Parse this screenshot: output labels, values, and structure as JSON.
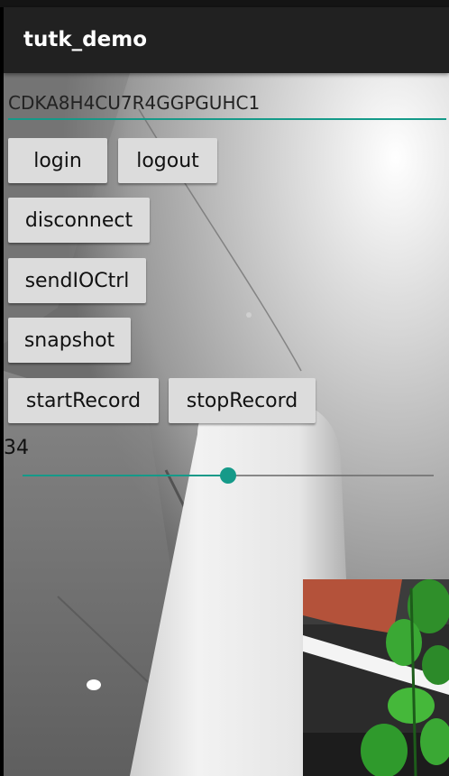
{
  "app_bar": {
    "title": "tutk_demo"
  },
  "uid_field": {
    "value": "CDKA8H4CU7R4GGPGUHC1"
  },
  "buttons": {
    "login": "login",
    "logout": "logout",
    "disconnect": "disconnect",
    "send_io_ctrl": "sendIOCtrl",
    "snapshot": "snapshot",
    "start_record": "startRecord",
    "stop_record": "stopRecord"
  },
  "seekbar": {
    "value_label": "34",
    "progress_fraction": 0.5
  },
  "colors": {
    "accent": "#159a89",
    "app_bar": "#212121",
    "button": "#dcdcdc"
  },
  "video": {
    "main_feed": "live-camera-feed",
    "local_preview": "local-camera-preview"
  }
}
